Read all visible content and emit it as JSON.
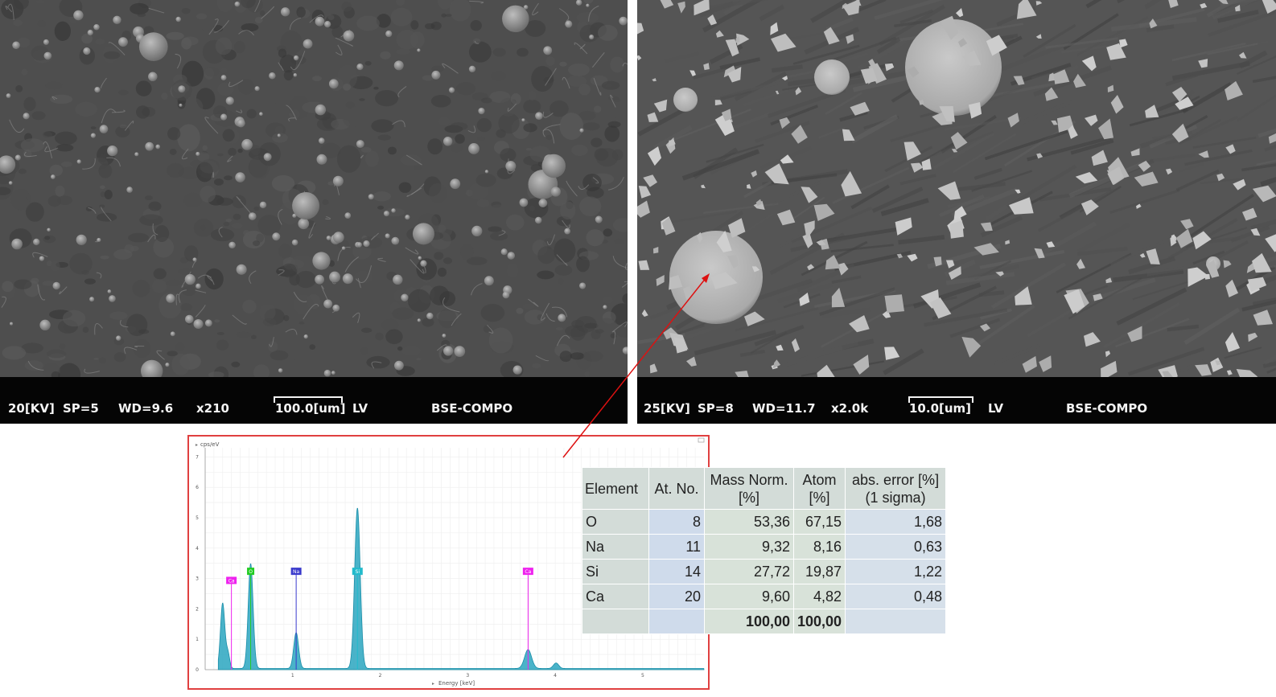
{
  "sem_left": {
    "kv": "20[KV]",
    "sp": "SP=5",
    "wd": "WD=9.6",
    "mag": "x210",
    "scale": "100.0[um]",
    "mode": "LV",
    "detector": "BSE-COMPO"
  },
  "sem_right": {
    "kv": "25[KV]",
    "sp": "SP=8",
    "wd": "WD=11.7",
    "mag": "x2.0k",
    "scale": "10.0[um]",
    "mode": "LV",
    "detector": "BSE-COMPO"
  },
  "colors": {
    "arrow": "#dd1111",
    "spectrum_fill": "#2aa6c0",
    "label_ca": "#ee22ee",
    "label_o": "#22cc22",
    "label_na": "#3a3acc",
    "label_si": "#22bbcc"
  },
  "chart_data": {
    "type": "area",
    "ylabel": "cps/eV",
    "xlabel": "Energy [keV]",
    "xlim": [
      0,
      5.7
    ],
    "ylim": [
      0,
      7.3
    ],
    "x_ticks": [
      "1",
      "2",
      "3",
      "4",
      "5"
    ],
    "y_ticks": [
      "0",
      "1",
      "2",
      "3",
      "4",
      "5",
      "6",
      "7"
    ],
    "peak_labels": [
      {
        "text": "Ca",
        "x": 0.3
      },
      {
        "text": "O",
        "x": 0.52
      },
      {
        "text": "Na",
        "x": 1.04
      },
      {
        "text": "Si",
        "x": 1.74
      },
      {
        "text": "Ca",
        "x": 3.69
      }
    ],
    "peaks": [
      {
        "x": 0.2,
        "y": 2.15,
        "w": 0.025
      },
      {
        "x": 0.26,
        "y": 0.5,
        "w": 0.02
      },
      {
        "x": 0.52,
        "y": 3.45,
        "w": 0.028
      },
      {
        "x": 1.04,
        "y": 1.18,
        "w": 0.028
      },
      {
        "x": 1.74,
        "y": 5.28,
        "w": 0.032
      },
      {
        "x": 3.69,
        "y": 0.62,
        "w": 0.04
      },
      {
        "x": 4.01,
        "y": 0.18,
        "w": 0.03
      }
    ]
  },
  "table": {
    "headers": [
      "Element",
      "At. No.",
      "Mass Norm.\n[%]",
      "Atom\n[%]",
      "abs. error [%]\n(1 sigma)"
    ],
    "rows": [
      [
        "O",
        "8",
        "53,36",
        "67,15",
        "1,68"
      ],
      [
        "Na",
        "11",
        "9,32",
        "8,16",
        "0,63"
      ],
      [
        "Si",
        "14",
        "27,72",
        "19,87",
        "1,22"
      ],
      [
        "Ca",
        "20",
        "9,60",
        "4,82",
        "0,48"
      ]
    ],
    "total": [
      "",
      "",
      "100,00",
      "100,00",
      ""
    ]
  }
}
